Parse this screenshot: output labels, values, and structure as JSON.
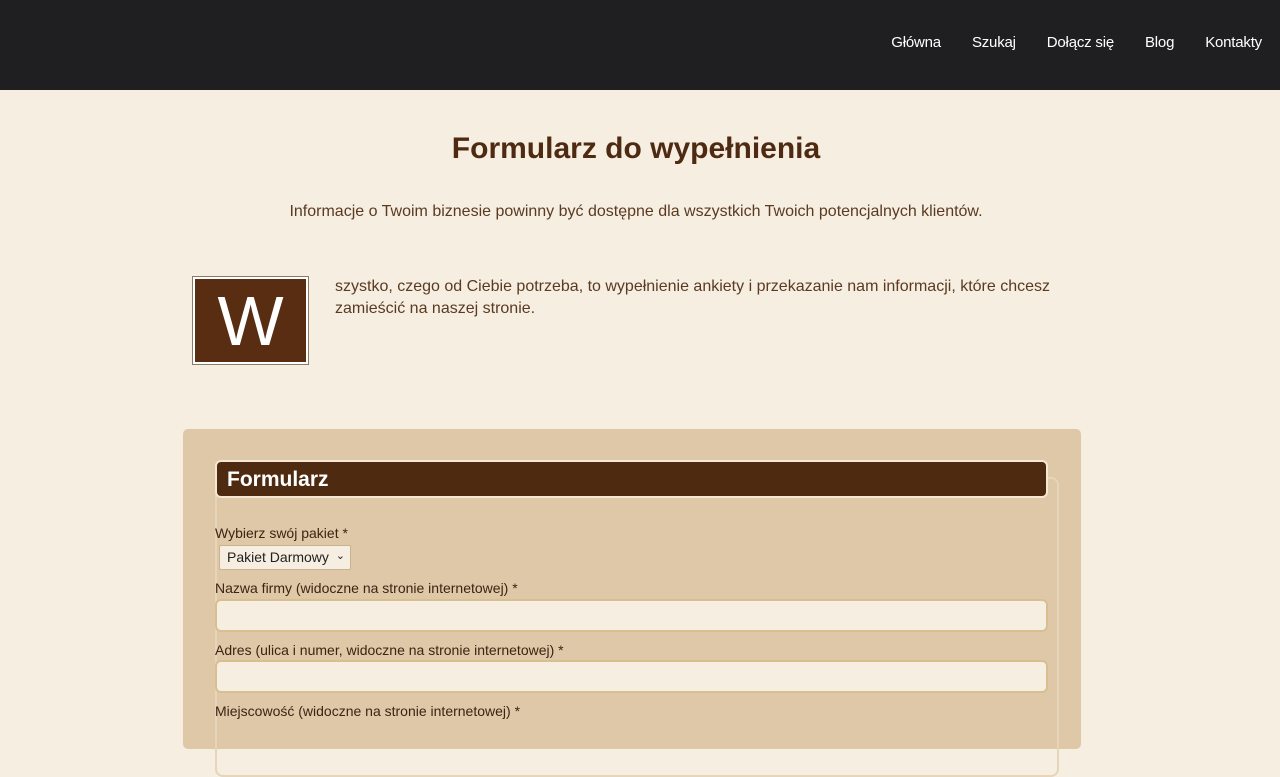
{
  "nav": {
    "items": [
      "Główna",
      "Szukaj",
      "Dołącz się",
      "Blog",
      "Kontakty"
    ]
  },
  "page": {
    "title": "Formularz do wypełnienia",
    "subtitle": "Informacje o Twoim biznesie powinny być dostępne dla wszystkich Twoich potencjalnych klientów.",
    "dropcap": "W",
    "intro": "szystko, czego od Ciebie potrzeba, to wypełnienie ankiety i przekazanie nam informacji, które chcesz zamieścić na naszej stronie."
  },
  "form": {
    "legend": "Formularz",
    "package_label": "Wybierz swój pakiet *",
    "package_value": "Pakiet Darmowy",
    "company_label": "Nazwa firmy (widoczne na stronie internetowej) *",
    "company_value": "",
    "address_label": "Adres (ulica i numer, widoczne na stronie internetowej) *",
    "address_value": "",
    "city_label": "Miejscowość (widoczne na stronie internetowej) *"
  },
  "colors": {
    "topbar": "#1f1f22",
    "background": "#f6eee0",
    "accent_brown": "#4e2a10",
    "form_panel": "#dec8a8"
  }
}
